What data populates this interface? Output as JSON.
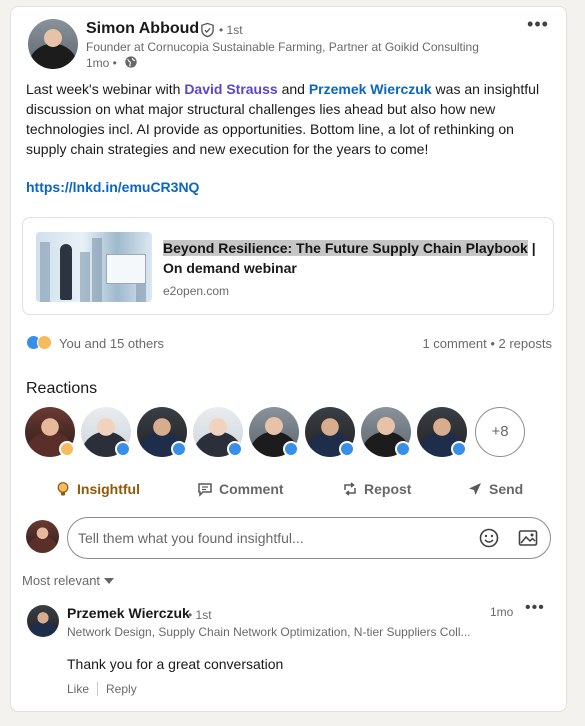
{
  "post": {
    "author_name": "Simon Abboud",
    "degree": "• 1st",
    "headline": "Founder at Cornucopia Sustainable Farming, Partner at Goikid Consulting",
    "time": "1mo •",
    "text_part1": "Last week's webinar with ",
    "mention1": "David Strauss",
    "text_part2": " and ",
    "mention2": "Przemek Wierczuk",
    "text_part3": " was an insightful discussion on what major structural challenges lies ahead but also how new technologies incl. AI provide as opportunities. Bottom line, a lot of rethinking on supply chain strategies and new execution for the years to come!",
    "link": "https://lnkd.in/emuCR3NQ",
    "more_icon": "more-horizontal-icon"
  },
  "link_card": {
    "title_highlight": "Beyond Resilience: The Future Supply Chain Playbook",
    "title_rest": " | On demand webinar",
    "domain": "e2open.com"
  },
  "social": {
    "reactions_summary": "You and 15 others",
    "counts": "1 comment • 2 reposts"
  },
  "reactions": {
    "title": "Reactions",
    "more_count": "+8"
  },
  "actions": {
    "insightful": "Insightful",
    "comment": "Comment",
    "repost": "Repost",
    "send": "Send"
  },
  "comment_box": {
    "placeholder": "Tell them what you found insightful..."
  },
  "sort": {
    "label": "Most relevant"
  },
  "comment": {
    "name": "Przemek Wierczuk",
    "degree": "• 1st",
    "time": "1mo",
    "headline": "Network Design, Supply Chain Network Optimization, N-tier Suppliers Coll...",
    "text": "Thank you for a great conversation",
    "like": "Like",
    "reply": "Reply"
  },
  "colors": {
    "link_blue": "#0a66c2",
    "mention_purple": "#5b44c9",
    "insightful_active": "#915907"
  }
}
